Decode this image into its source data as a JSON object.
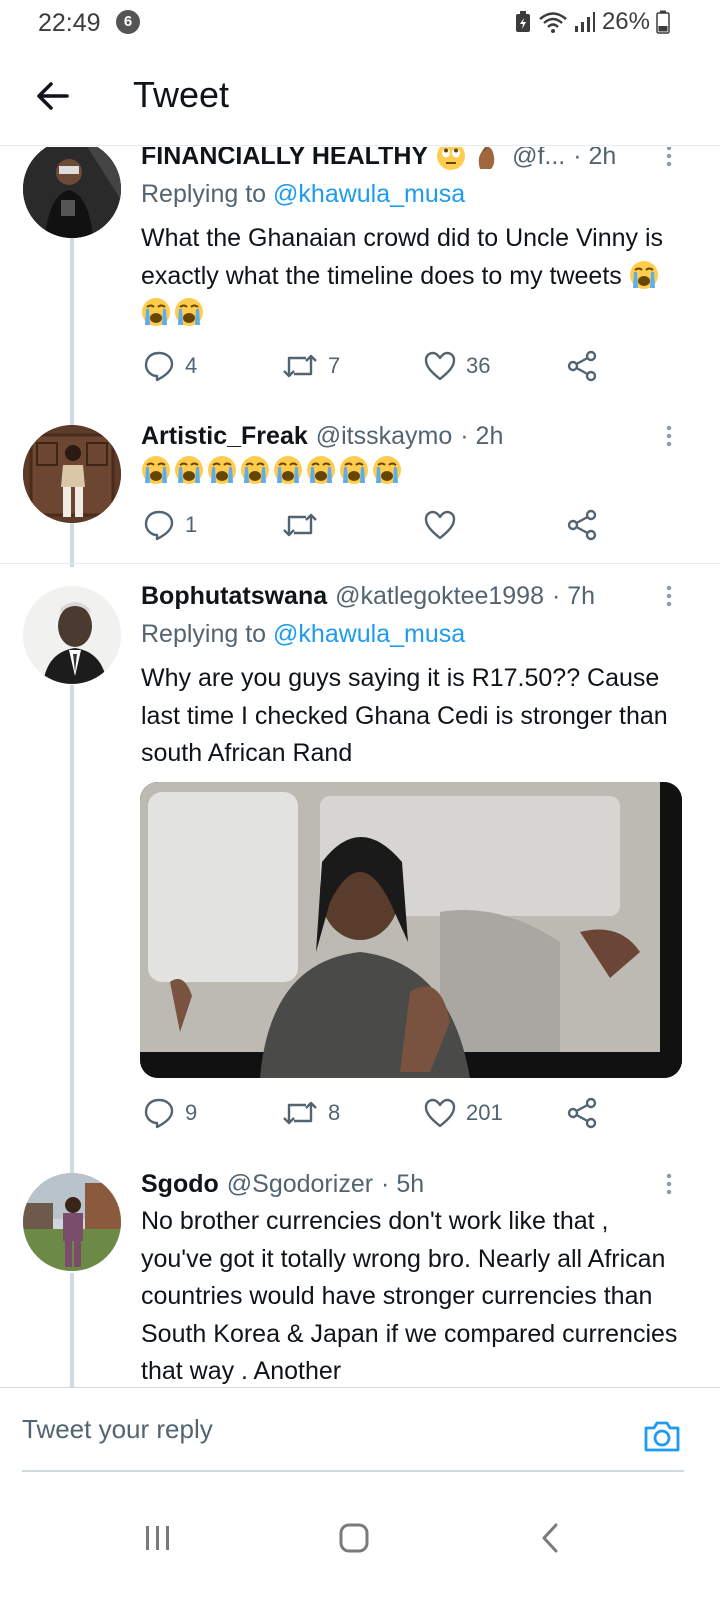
{
  "status_bar": {
    "time": "22:49",
    "notification_count": "6",
    "battery": "26%"
  },
  "header": {
    "title": "Tweet"
  },
  "tweets": [
    {
      "name": "FINANCIALLY HEALTHY",
      "handle": "@f...",
      "time": "· 2h",
      "replying_prefix": "Replying to",
      "replying_to": "@khawula_musa",
      "text": "What the Ghanaian crowd did to Uncle Vinny is exactly what the timeline does to my tweets",
      "replies": "4",
      "retweets": "7",
      "likes": "36"
    },
    {
      "name": "Artistic_Freak",
      "handle": "@itsskaymo",
      "time": "· 2h",
      "replies": "1",
      "retweets": "",
      "likes": ""
    },
    {
      "name": "Bophutatswana",
      "handle": "@katlegoktee1998",
      "time": "· 7h",
      "replying_prefix": "Replying to",
      "replying_to": "@khawula_musa",
      "text": "Why are you guys saying it is R17.50?? Cause last time I checked Ghana Cedi is stronger than south African Rand",
      "replies": "9",
      "retweets": "8",
      "likes": "201"
    },
    {
      "name": "Sgodo",
      "handle": "@Sgodorizer",
      "time": "· 5h",
      "text": "No brother currencies don't work like that , you've got it totally wrong bro. Nearly all African countries would have stronger currencies than South Korea  & Japan if we compared currencies that way . Another"
    }
  ],
  "reply_bar": {
    "placeholder": "Tweet your reply"
  },
  "colors": {
    "accent": "#1d9bf0",
    "secondary_text": "#536471",
    "thread_line": "#cfd9de"
  }
}
